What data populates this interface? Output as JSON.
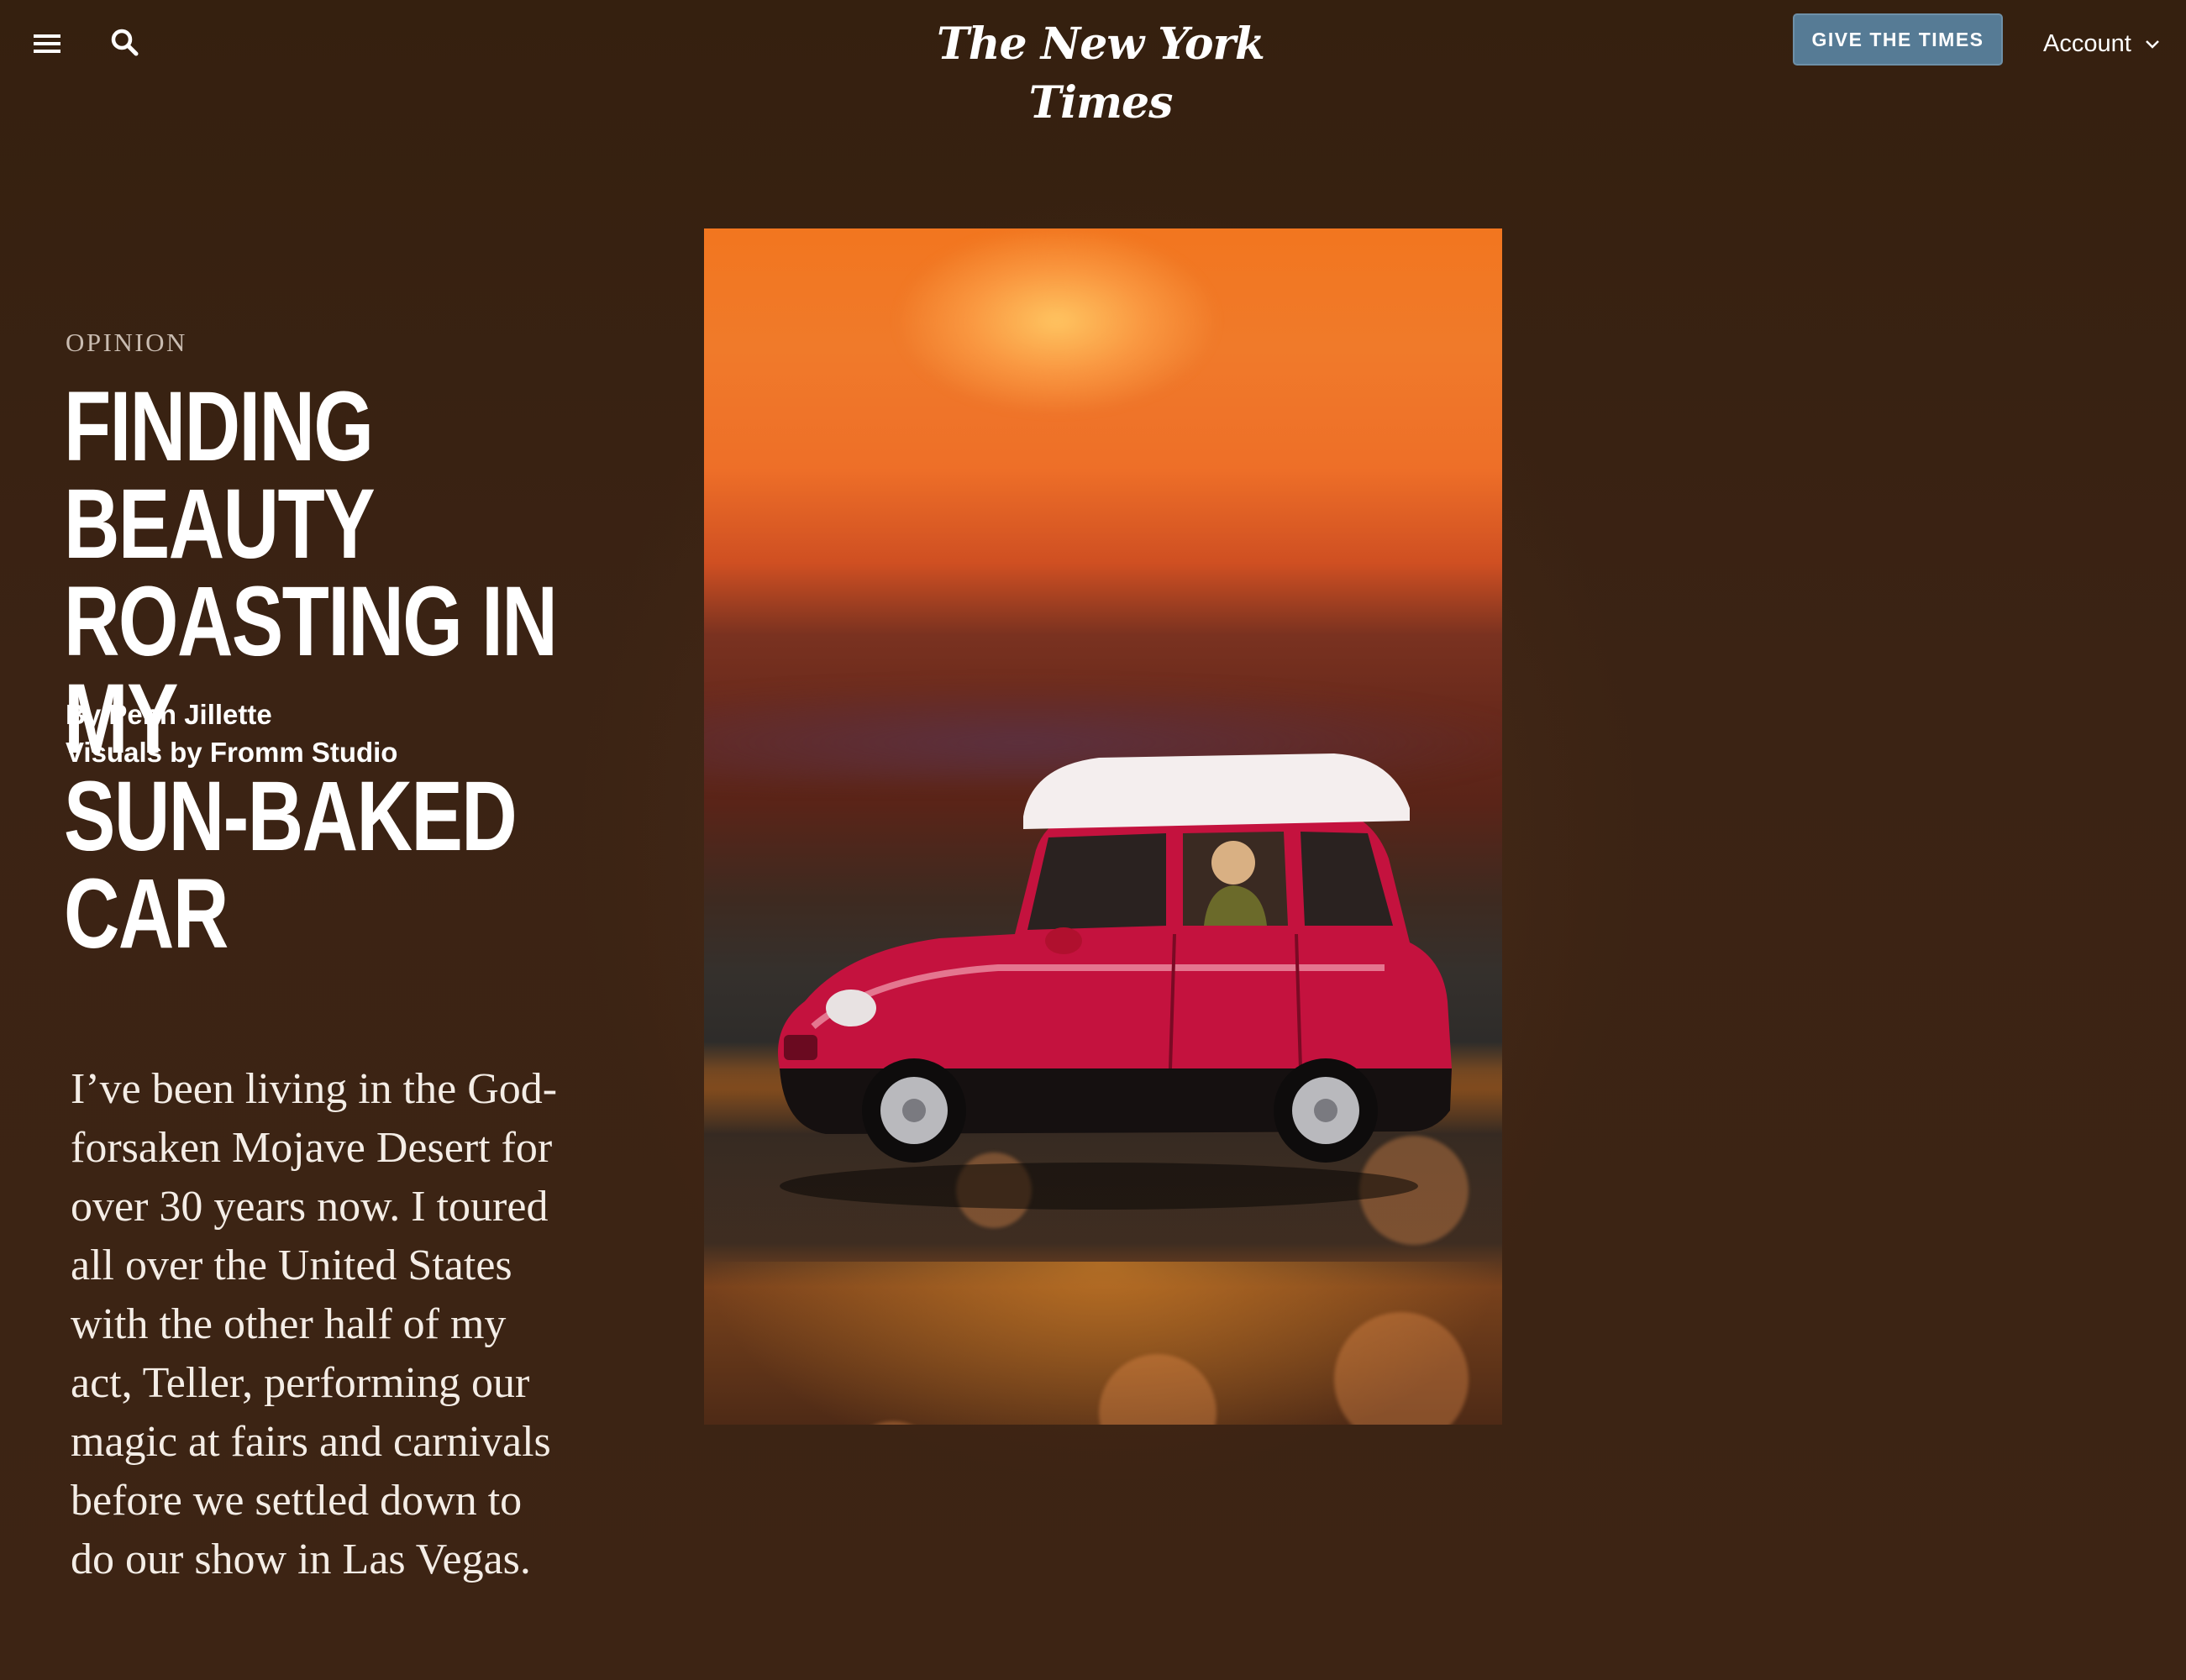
{
  "header": {
    "logo": "The New York Times",
    "give_button": "GIVE THE TIMES",
    "account_label": "Account"
  },
  "icons": {
    "menu": "hamburger-menu-icon",
    "search": "magnifier-search-icon",
    "chevron": "chevron-down-icon"
  },
  "article": {
    "kicker": "OPINION",
    "headline_lines": [
      "FINDING BEAUTY",
      "ROASTING IN MY",
      "SUN-BAKED CAR"
    ],
    "byline_author": "By Penn Jillette",
    "byline_visuals": "Visuals by Fromm Studio",
    "lede_lines": [
      "I’ve been living in the God-",
      "forsaken Mojave Desert for",
      "over 30 years now. I toured",
      "all over the United States",
      "with the other half of my",
      "act, Teller, performing our",
      "magic at fairs and carnivals",
      "before we settled down to",
      "do our show in Las Vegas."
    ]
  },
  "colors": {
    "page_background": "#3b2314",
    "button_blue": "#567b95",
    "car_red": "#c4123e"
  }
}
